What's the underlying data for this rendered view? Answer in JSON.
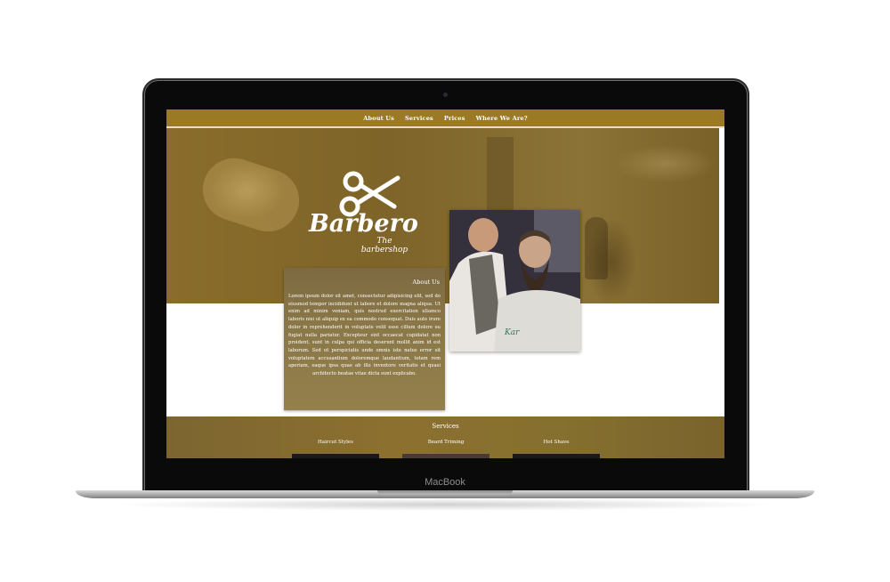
{
  "device": {
    "label": "MacBook"
  },
  "nav": {
    "items": [
      "About Us",
      "Services",
      "Prices",
      "Where We Are?"
    ]
  },
  "brand": {
    "name": "Barbero",
    "tagline": "The barbershop"
  },
  "about": {
    "title": "About Us",
    "text": "Lorem ipsum dolor sit amet, consectetur adipisicing elit, sed do eiusmod tempor incididunt ut labore et dolore magna aliqua. Ut enim ad minim veniam, quis nostrud exercitation ullamco laboris nisi ut aliquip ex ea commodo consequat. Duis aute irure dolor in reprehenderit in voluptate velit esse cillum dolore eu fugiat nulla pariatur. Excepteur sint occaecat cupidatat non proident, sunt in culpa qui officia deserunt mollit anim id est laborum. Sed ut perspiciatis unde omnis iste natus error sit voluptatem accusantium doloremque laudantium, totam rem aperiam, eaque ipsa quae ab illo inventore veritatis et quasi architecto beatae vitae dicta sunt explicabo."
  },
  "services": {
    "title": "Services",
    "items": [
      "Haircut Styles",
      "Beard Triming",
      "Hot Shave"
    ]
  },
  "colors": {
    "nav": "#9c7925",
    "hero_overlay": "#8a6d2c",
    "white": "#ffffff"
  }
}
